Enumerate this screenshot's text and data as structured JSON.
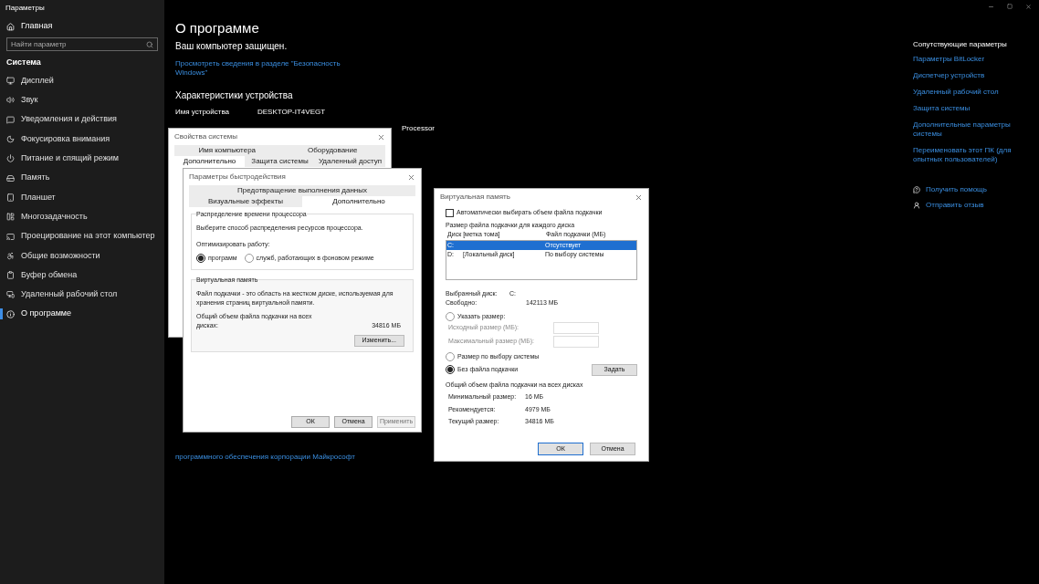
{
  "window": {
    "title": "Параметры"
  },
  "sidebar": {
    "home": "Главная",
    "search": {
      "placeholder": "Найти параметр"
    },
    "section": "Система",
    "items": [
      {
        "label": "Дисплей",
        "selected": false
      },
      {
        "label": "Звук",
        "selected": false
      },
      {
        "label": "Уведомления и действия",
        "selected": false
      },
      {
        "label": "Фокусировка внимания",
        "selected": false
      },
      {
        "label": "Питание и спящий режим",
        "selected": false
      },
      {
        "label": "Память",
        "selected": false
      },
      {
        "label": "Планшет",
        "selected": false
      },
      {
        "label": "Многозадачность",
        "selected": false
      },
      {
        "label": "Проецирование на этот компьютер",
        "selected": false
      },
      {
        "label": "Общие возможности",
        "selected": false
      },
      {
        "label": "Буфер обмена",
        "selected": false
      },
      {
        "label": "Удаленный рабочий стол",
        "selected": false
      },
      {
        "label": "О программе",
        "selected": true
      }
    ]
  },
  "main": {
    "title": "О программе",
    "security_status": "Ваш компьютер защищен.",
    "security_link": "Просмотреть сведения в разделе \"Безопасность Windows\"",
    "specs_heading": "Характеристики устройства",
    "specs": [
      {
        "label": "Имя устройства",
        "value": "DESKTOP-IT4VEGT"
      }
    ],
    "processor_fragment": "Processor",
    "footer_link": "программного обеспечения корпорации Майкрософт"
  },
  "related": {
    "title": "Сопутствующие параметры",
    "links": [
      "Параметры BitLocker",
      "Диспетчер устройств",
      "Удаленный рабочий стол",
      "Защита системы",
      "Дополнительные параметры системы",
      "Переименовать этот ПК (для опытных пользователей)"
    ],
    "help": [
      "Получить помощь",
      "Отправить отзыв"
    ]
  },
  "system_properties": {
    "title": "Свойства системы",
    "tab_rows": [
      [
        {
          "label": "Имя компьютера",
          "selected": false
        },
        {
          "label": "Оборудование",
          "selected": false
        }
      ],
      [
        {
          "label": "Дополнительно",
          "selected": true
        },
        {
          "label": "Защита системы",
          "selected": false
        },
        {
          "label": "Удаленный доступ",
          "selected": false
        }
      ]
    ]
  },
  "performance_options": {
    "title": "Параметры быстродействия",
    "tab_rows": [
      [
        {
          "label": "Предотвращение выполнения данных",
          "selected": false
        }
      ],
      [
        {
          "label": "Визуальные эффекты",
          "selected": false
        },
        {
          "label": "Дополнительно",
          "selected": true
        }
      ]
    ],
    "cpu_group": {
      "title": "Распределение времени процессора",
      "description": "Выберите способ распределения ресурсов процессора.",
      "optimize_label": "Оптимизировать работу:",
      "options": [
        {
          "label": "программ",
          "selected": true
        },
        {
          "label": "служб, работающих в фоновом режиме",
          "selected": false
        }
      ]
    },
    "vm_group": {
      "title": "Виртуальная память",
      "description": "Файл подкачки - это область на жестком диске, используемая для хранения страниц виртуальной памяти.",
      "total_label": "Общий объем файла подкачки на всех дисках:",
      "total_value": "34816 МБ",
      "change_button": "Изменить..."
    },
    "buttons": [
      {
        "label": "ОК",
        "disabled": false
      },
      {
        "label": "Отмена",
        "disabled": false
      },
      {
        "label": "Применить",
        "disabled": true
      }
    ]
  },
  "virtual_memory": {
    "title": "Виртуальная память",
    "auto": {
      "label": "Автоматически выбирать объем файла подкачки",
      "checked": false
    },
    "per_disk_label": "Размер файла подкачки для каждого диска",
    "columns": [
      "Диск [метка тома]",
      "Файл подкачки (МБ)"
    ],
    "drives": [
      {
        "drive": "C:",
        "paging": "Отсутствует",
        "selected": true
      },
      {
        "drive": "D:",
        "volume_label": "[Локальный диск]",
        "paging": "По выбору системы",
        "selected": false
      }
    ],
    "selected_drive_label": "Выбранный диск:",
    "selected_drive": "C:",
    "free_label": "Свободно:",
    "free_value": "142113 МБ",
    "options": [
      {
        "label": "Указать размер:",
        "selected": false
      },
      {
        "label": "Размер по выбору системы",
        "selected": false
      },
      {
        "label": "Без файла подкачки",
        "selected": true
      }
    ],
    "initial_label": "Исходный размер (МБ):",
    "max_label": "Максимальный размер (МБ):",
    "set_button": "Задать",
    "totals_title": "Общий объем файла подкачки на всех дисках",
    "totals": [
      {
        "label": "Минимальный размер:",
        "value": "16 МБ"
      },
      {
        "label": "Рекомендуется:",
        "value": "4979 МБ"
      },
      {
        "label": "Текущий размер:",
        "value": "34816 МБ"
      }
    ],
    "buttons": [
      "ОК",
      "Отмена"
    ]
  }
}
